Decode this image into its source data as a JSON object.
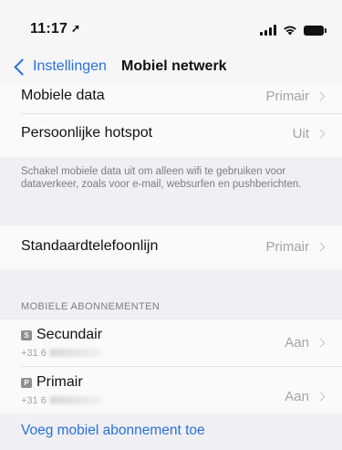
{
  "status_bar": {
    "time": "11:17",
    "location_glyph": "➚"
  },
  "navbar": {
    "back_label": "Instellingen",
    "title": "Mobiel netwerk"
  },
  "group1": {
    "rows": [
      {
        "label": "Mobiele data",
        "value": "Primair"
      },
      {
        "label": "Persoonlijke hotspot",
        "value": "Uit"
      }
    ],
    "footer": "Schakel mobiele data uit om alleen wifi te gebruiken voor dataverkeer, zoals voor e-mail, websurfen en pushberichten."
  },
  "group2": {
    "rows": [
      {
        "label": "Standaardtelefoonlijn",
        "value": "Primair"
      }
    ]
  },
  "plans": {
    "header": "MOBIELE ABONNEMENTEN",
    "items": [
      {
        "badge": "S",
        "label": "Secundair",
        "number_prefix": "+31 6",
        "value": "Aan"
      },
      {
        "badge": "P",
        "label": "Primair",
        "number_prefix": "+31 6",
        "value": "Aan"
      }
    ],
    "add_label": "Voeg mobiel abonnement toe"
  },
  "colors": {
    "accent": "#2b71d8",
    "background": "#efeff4",
    "cell": "#fafafa",
    "secondary_text": "#a3a3a8"
  }
}
